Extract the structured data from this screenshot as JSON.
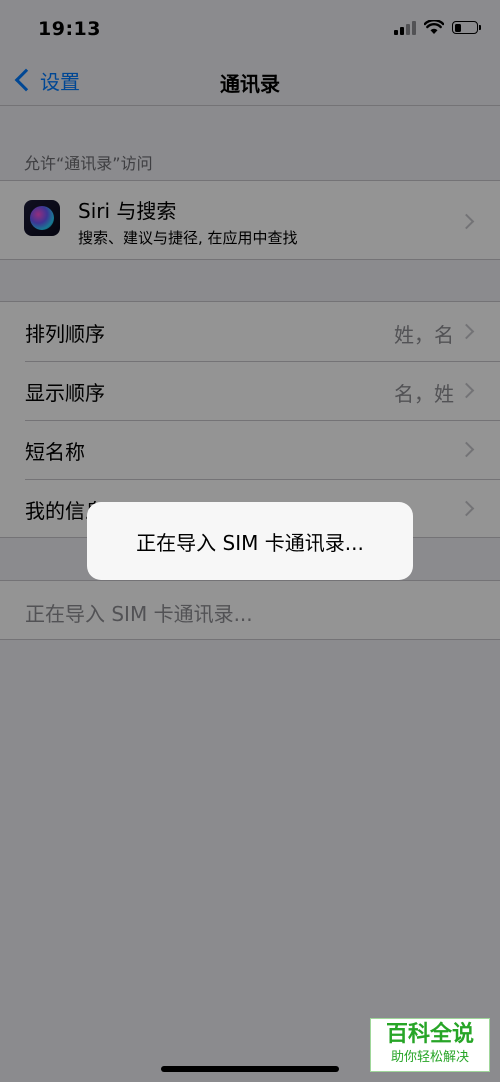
{
  "status_bar": {
    "time": "19:13",
    "signal_icon": "cellular-signal-icon",
    "wifi_icon": "wifi-icon",
    "battery_icon": "battery-icon",
    "battery_level": 0.3
  },
  "nav": {
    "back_label": "设置",
    "title": "通讯录"
  },
  "allow_section": {
    "header": "允许“通讯录”访问",
    "siri_item": {
      "icon": "siri-icon",
      "title": "Siri 与搜索",
      "subtitle": "搜索、建议与捷径, 在应用中查找"
    }
  },
  "settings_rows": [
    {
      "label": "排列顺序",
      "value": "姓，名"
    },
    {
      "label": "显示顺序",
      "value": "名，姓"
    },
    {
      "label": "短名称",
      "value": ""
    },
    {
      "label": "我的信息",
      "value": ""
    }
  ],
  "import_row": {
    "label": "正在导入 SIM 卡通讯录..."
  },
  "toast": {
    "message": "正在导入 SIM 卡通讯录..."
  },
  "watermark": {
    "title": "百科全说",
    "subtitle": "助你轻松解决"
  },
  "colors": {
    "accent": "#007aff",
    "background": "#efeff4",
    "watermark": "#27a527"
  }
}
